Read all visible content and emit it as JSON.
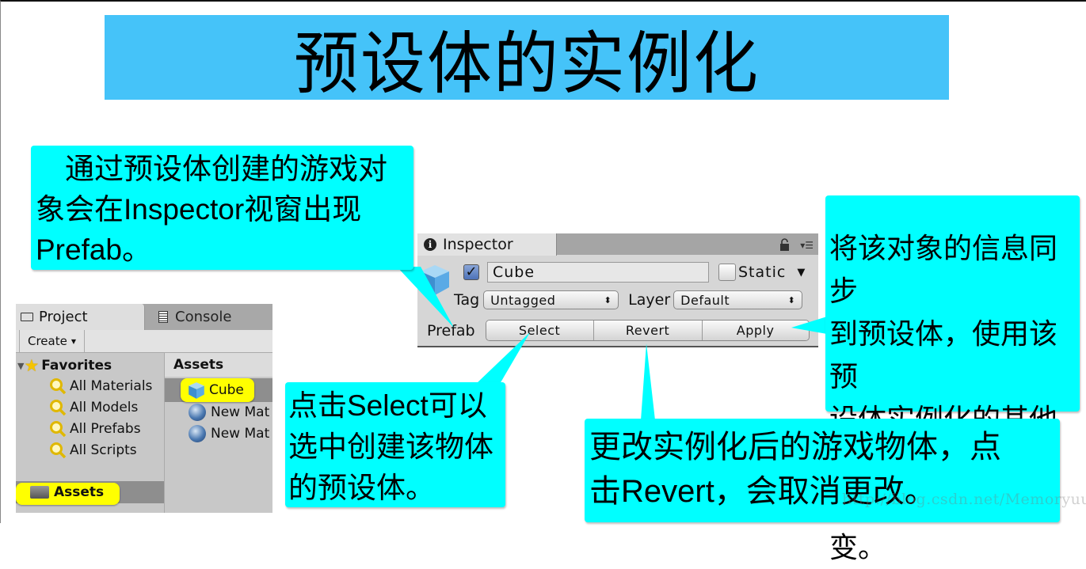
{
  "title": "预设体的实例化",
  "callouts": {
    "prefab_note_line1": "通过预设体创建的游戏对",
    "prefab_note_line2": "象会在Inspector视窗出现",
    "prefab_note_line3": "Prefab。",
    "apply_note": [
      "将该对象的信息同步",
      "到预设体，使用该预",
      "设体实例化的其他游",
      "戏对象也随之改变。"
    ],
    "select_note": [
      "点击Select可以",
      "选中创建该物体",
      "的预设体。"
    ],
    "revert_note": [
      "更改实例化后的游戏物体，点",
      "击Revert，会取消更改。"
    ]
  },
  "inspector": {
    "tab_label": "Inspector",
    "object_name": "Cube",
    "active_checked": true,
    "static_label": "Static",
    "static_checked": false,
    "tag_label": "Tag",
    "tag_value": "Untagged",
    "layer_label": "Layer",
    "layer_value": "Default",
    "prefab_label": "Prefab",
    "buttons": {
      "select": "Select",
      "revert": "Revert",
      "apply": "Apply"
    },
    "icons": [
      "info-icon",
      "lock-icon",
      "menu-icon",
      "cube-icon",
      "dropdown-arrow-icon"
    ]
  },
  "project": {
    "tabs": [
      "Project",
      "Console"
    ],
    "create_label": "Create",
    "favorites_label": "Favorites",
    "favorites": [
      "All Materials",
      "All Models",
      "All Prefabs",
      "All Scripts"
    ],
    "root_folder": "Assets",
    "assets_header": "Assets",
    "assets": [
      "Cube",
      "New Mat",
      "New Mat"
    ]
  },
  "watermark": "http://blog.csdn.net/Memoryuuu",
  "colors": {
    "title_bg": "#45c3f9",
    "callout_bg": "#00ffff",
    "highlight": "#ffff00"
  }
}
